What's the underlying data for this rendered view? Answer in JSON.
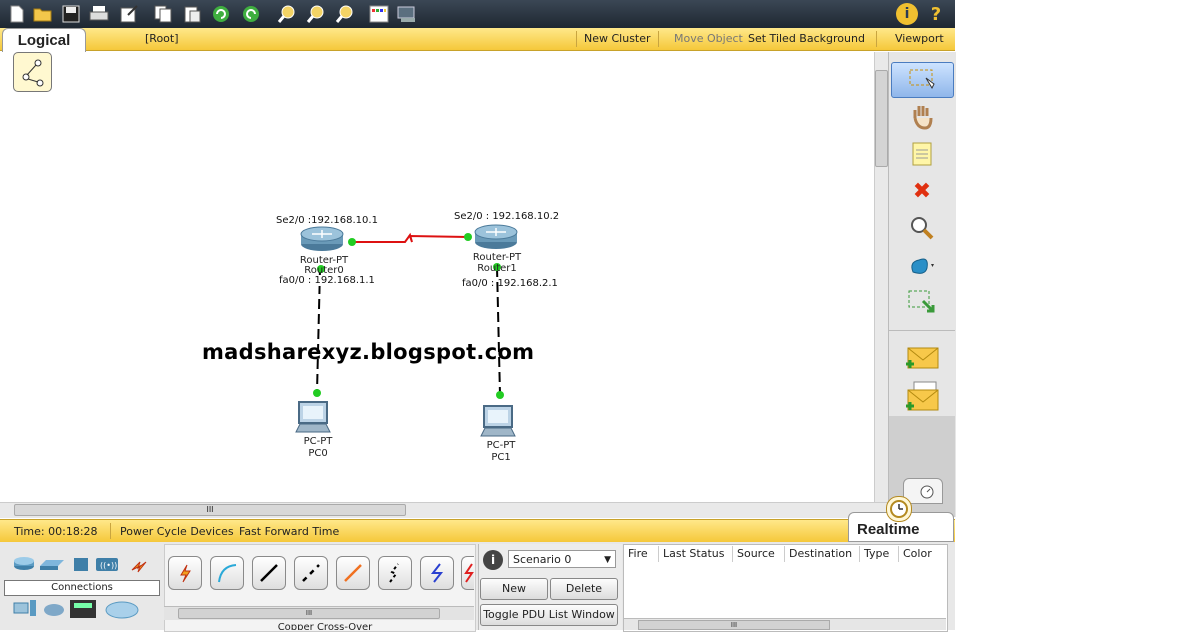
{
  "toolbar": {
    "icons": [
      "new-icon",
      "open-icon",
      "save-icon",
      "print-icon",
      "activity-wizard-icon",
      "copy-icon",
      "paste-icon",
      "undo-icon",
      "redo-icon",
      "zoom-in-icon",
      "zoom-reset-icon",
      "zoom-out-icon",
      "palette-icon",
      "custom-device-icon"
    ],
    "help_info": "i",
    "help_question": "?"
  },
  "workspace_bar": {
    "tab": "Logical",
    "root": "[Root]",
    "new_cluster": "New Cluster",
    "move_object": "Move Object",
    "set_tiled_background": "Set Tiled Background",
    "viewport": "Viewport"
  },
  "canvas": {
    "watermark": "madsharexyz.blogspot.com",
    "devices": {
      "router0": {
        "type": "Router-PT",
        "name": "Router0",
        "serial": "Se2/0 :192.168.10.1",
        "fa": "fa0/0 : 192.168.1.1"
      },
      "router1": {
        "type": "Router-PT",
        "name": "Router1",
        "serial": "Se2/0 : 192.168.10.2",
        "fa": "fa0/0 : 192.168.2.1"
      },
      "pc0": {
        "type": "PC-PT",
        "name": "PC0"
      },
      "pc1": {
        "type": "PC-PT",
        "name": "PC1"
      }
    },
    "links": [
      {
        "from": "Router0",
        "to": "Router1",
        "kind": "serial",
        "color": "#dd1111"
      },
      {
        "from": "Router0",
        "to": "PC0",
        "kind": "copper-cross-over",
        "color": "#000000"
      },
      {
        "from": "Router1",
        "to": "PC1",
        "kind": "copper-cross-over",
        "color": "#000000"
      }
    ],
    "link_up_color": "#22cc22"
  },
  "right_tools": [
    "select-icon",
    "move-layout-icon",
    "note-icon",
    "delete-icon",
    "inspect-icon",
    "draw-shape-icon",
    "resize-icon",
    "add-simple-pdu-icon",
    "add-complex-pdu-icon"
  ],
  "statusbar": {
    "time": "Time: 00:18:28",
    "power_cycle": "Power Cycle Devices",
    "fast_forward": "Fast Forward Time",
    "mode": "Realtime"
  },
  "device_panel": {
    "category_label": "Connections",
    "selected_cable": "Copper Cross-Over",
    "cables": [
      "auto-connection-icon",
      "console-cable-icon",
      "copper-straight-through-icon",
      "copper-cross-over-icon",
      "fiber-icon",
      "phone-cable-icon",
      "coaxial-icon",
      "serial-dce-icon"
    ]
  },
  "scenario": {
    "selected": "Scenario 0",
    "new_label": "New",
    "delete_label": "Delete",
    "toggle_label": "Toggle PDU List Window"
  },
  "pdu_table": {
    "columns": [
      "Fire",
      "Last Status",
      "Source",
      "Destination",
      "Type",
      "Color"
    ]
  },
  "scroll_grip": "III"
}
